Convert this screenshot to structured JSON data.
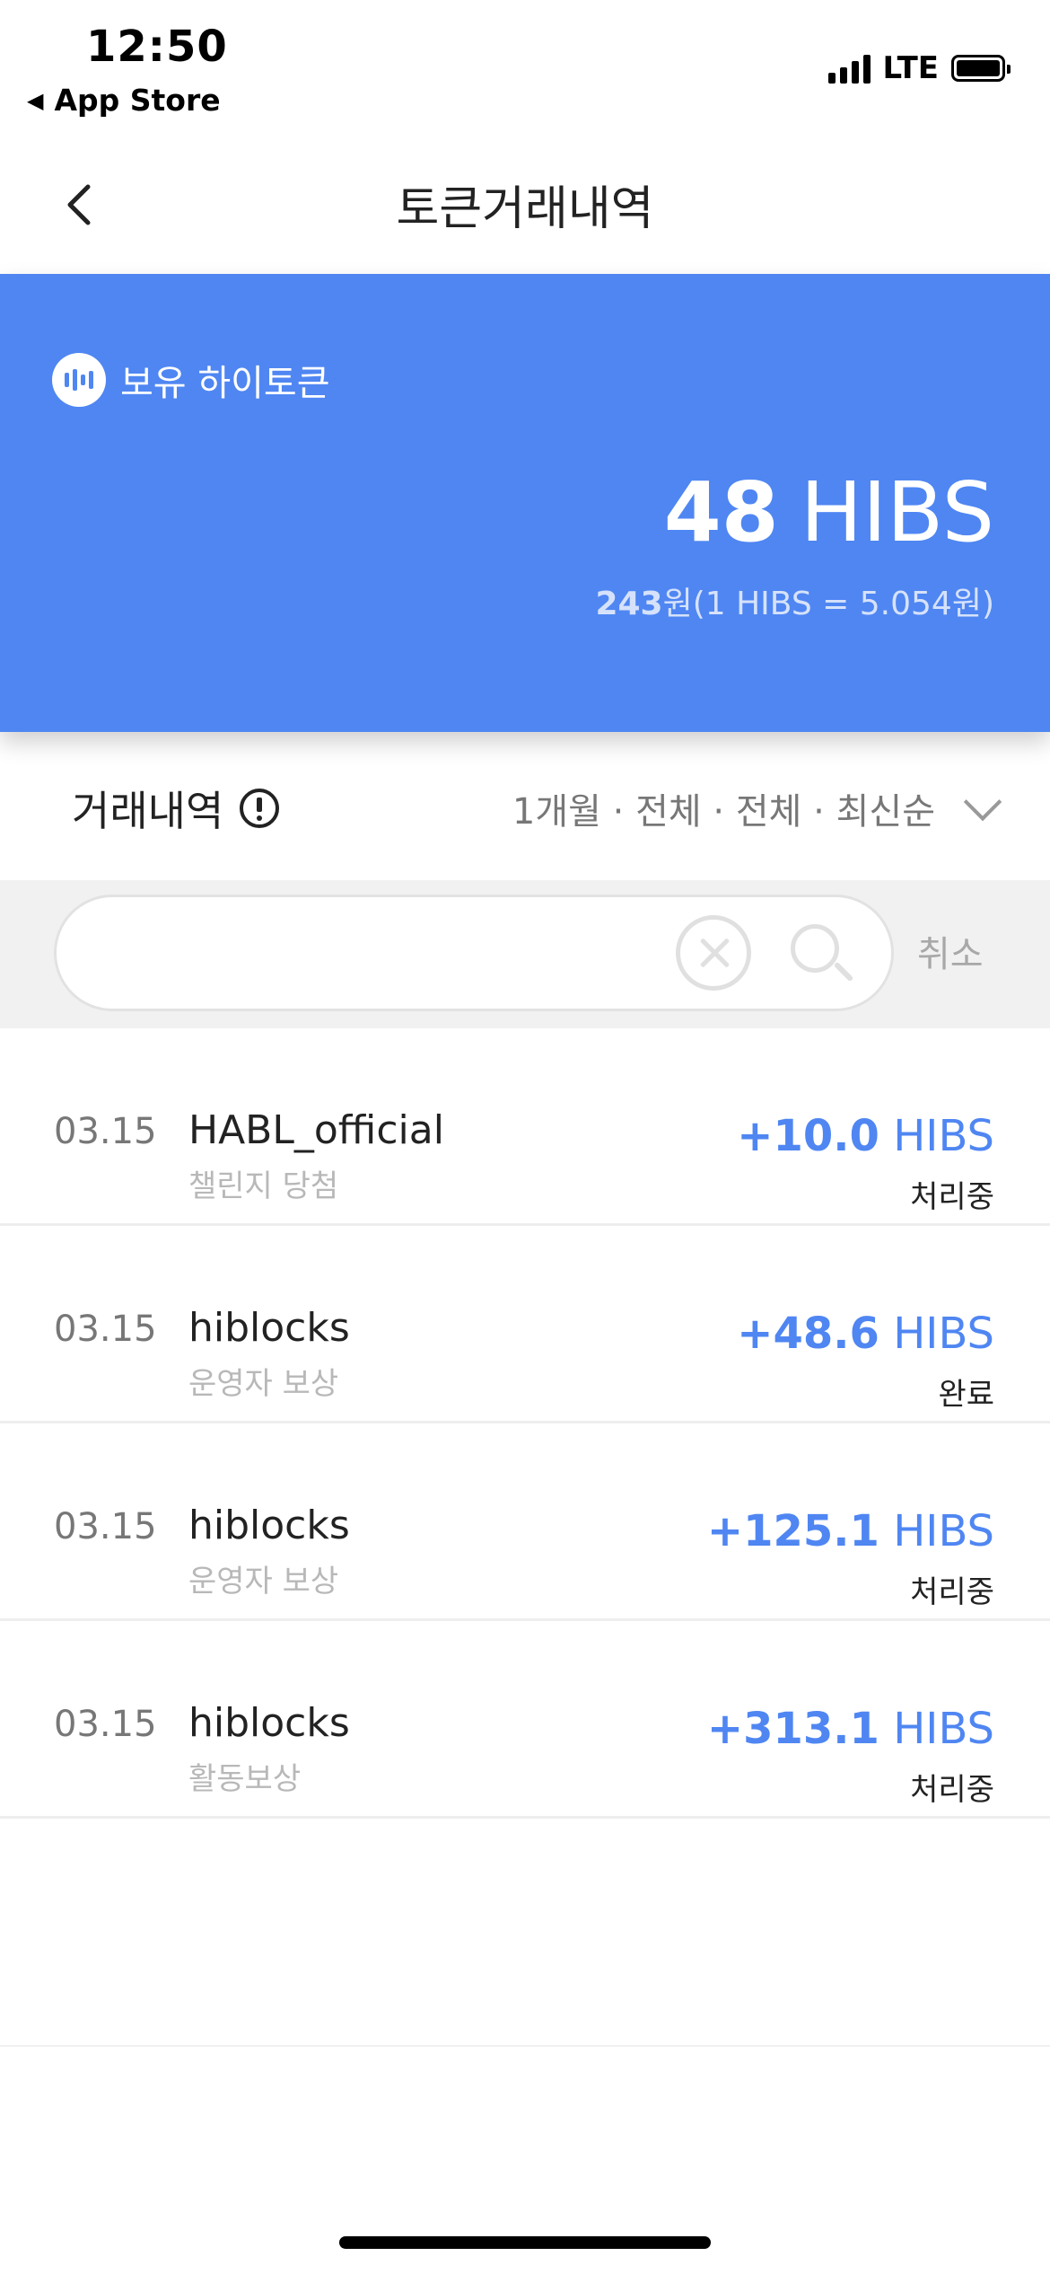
{
  "status_bar": {
    "time": "12:50",
    "back_app": "App Store",
    "network": "LTE"
  },
  "header": {
    "title": "토큰거래내역"
  },
  "balance_card": {
    "label": "보유 하이토큰",
    "amount": "48",
    "unit": "HIBS",
    "krw_value": "243",
    "krw_suffix": "원(1 HIBS = 5.054원)",
    "accent_color": "#4f86f2"
  },
  "history": {
    "title": "거래내역",
    "filter_text": "1개월 · 전체 · 전체 · 최신순"
  },
  "search": {
    "placeholder": "",
    "value": "",
    "cancel_label": "취소"
  },
  "transactions": [
    {
      "date": "03.15",
      "name": "HABL_official",
      "type": "챌린지 당첨",
      "amount": "+10.0",
      "unit": "HIBS",
      "status": "처리중"
    },
    {
      "date": "03.15",
      "name": "hiblocks",
      "type": "운영자 보상",
      "amount": "+48.6",
      "unit": "HIBS",
      "status": "완료"
    },
    {
      "date": "03.15",
      "name": "hiblocks",
      "type": "운영자 보상",
      "amount": "+125.1",
      "unit": "HIBS",
      "status": "처리중"
    },
    {
      "date": "03.15",
      "name": "hiblocks",
      "type": "활동보상",
      "amount": "+313.1",
      "unit": "HIBS",
      "status": "처리중"
    }
  ]
}
